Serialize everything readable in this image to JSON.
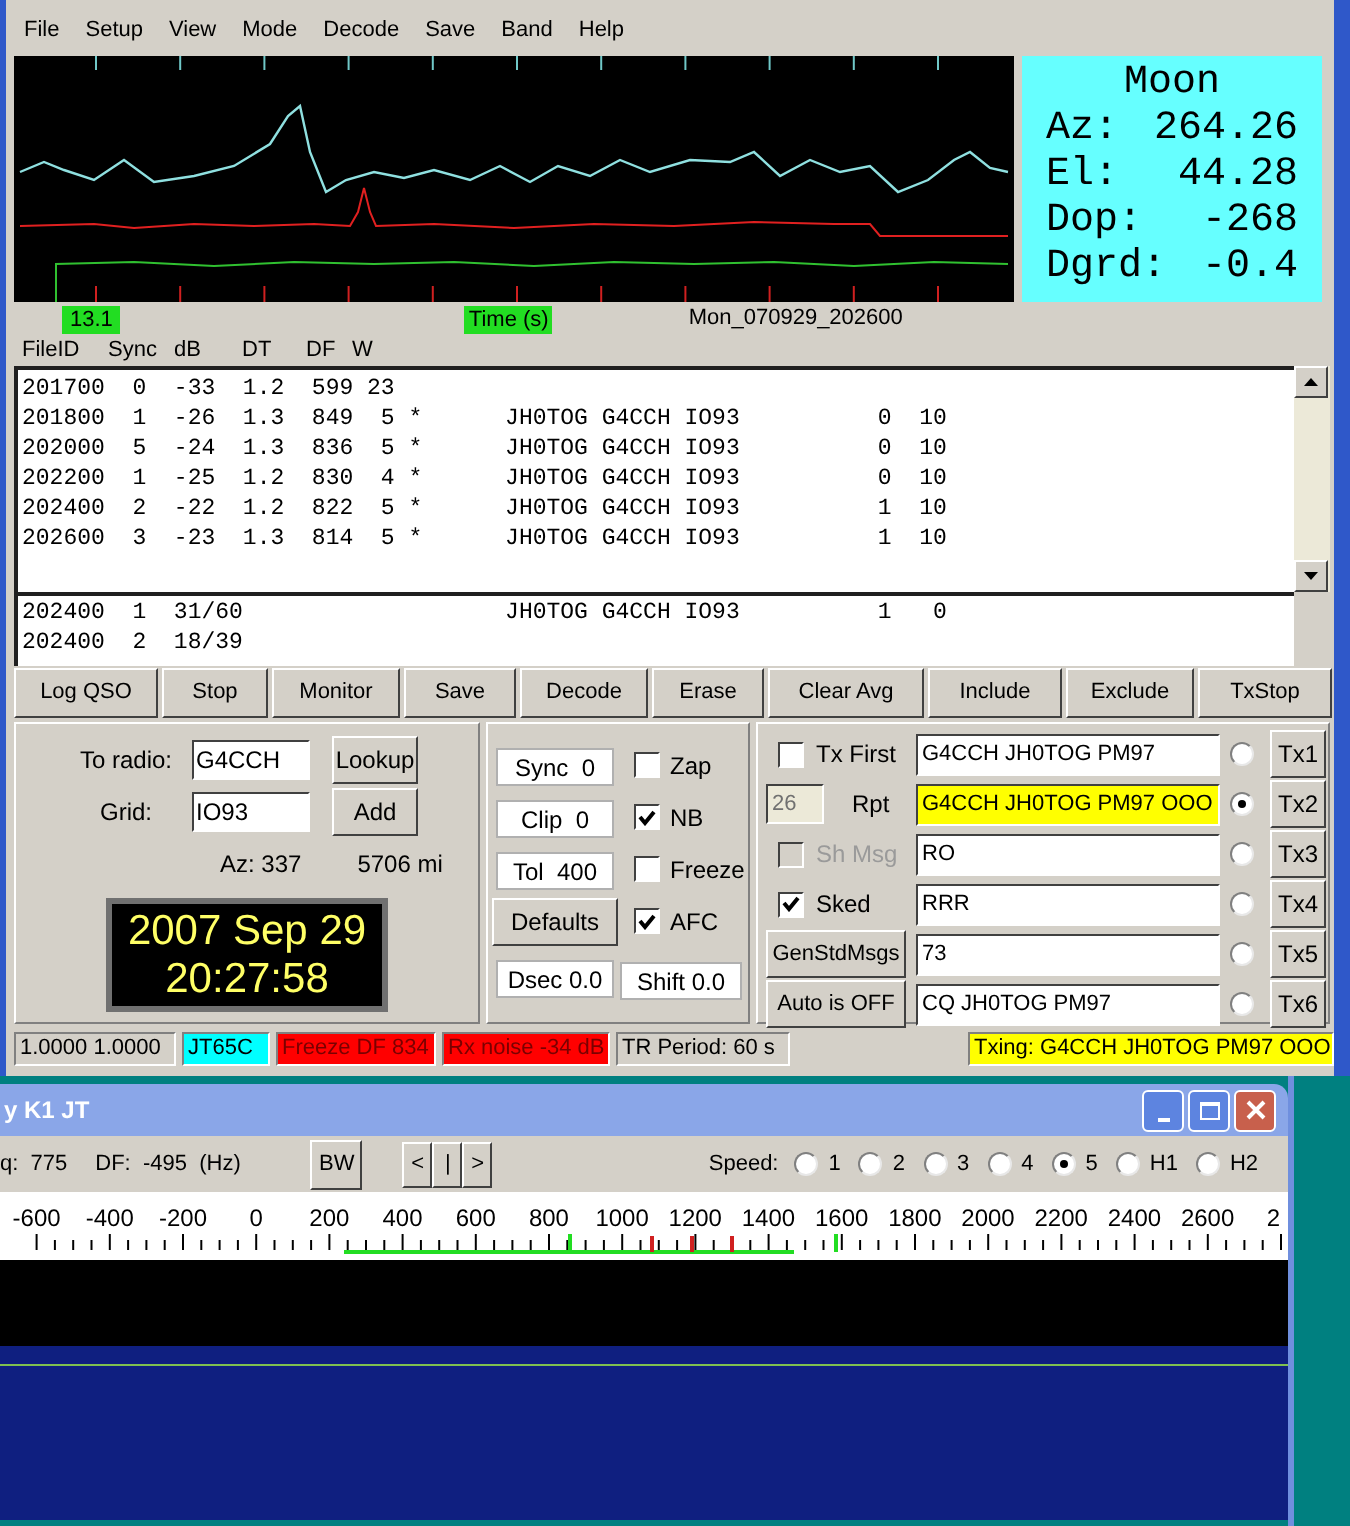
{
  "menu": [
    "File",
    "Setup",
    "View",
    "Mode",
    "Decode",
    "Save",
    "Band",
    "Help"
  ],
  "plot": {
    "readout": "13.1",
    "axis_label": "Time (s)",
    "file_name": "Mon_070929_202600"
  },
  "moon": {
    "title": "Moon",
    "rows": [
      {
        "label": "Az:",
        "value": "264.26"
      },
      {
        "label": "El:",
        "value": "44.28"
      },
      {
        "label": "Dop:",
        "value": "-268"
      },
      {
        "label": "Dgrd:",
        "value": "-0.4"
      }
    ]
  },
  "decoded": {
    "columns": [
      "FileID",
      "Sync",
      "dB",
      "DT",
      "DF",
      "W"
    ],
    "lines": [
      "201700  0  -33  1.2  599 23",
      "201800  1  -26  1.3  849  5 *      JH0TOG G4CCH IO93          0  10",
      "202000  5  -24  1.3  836  5 *      JH0TOG G4CCH IO93          0  10",
      "202200  1  -25  1.2  830  4 *      JH0TOG G4CCH IO93          0  10",
      "202400  2  -22  1.2  822  5 *      JH0TOG G4CCH IO93          1  10",
      "202600  3  -23  1.3  814  5 *      JH0TOG G4CCH IO93          1  10"
    ]
  },
  "average": {
    "lines": [
      "202400  1  31/60                   JH0TOG G4CCH IO93          1   0",
      "202400  2  18/39"
    ]
  },
  "buttons": [
    {
      "label": "Log QSO"
    },
    {
      "label": "Stop"
    },
    {
      "label": "Monitor"
    },
    {
      "label": "Save"
    },
    {
      "label": "Decode"
    },
    {
      "label": "Erase"
    },
    {
      "label": "Clear Avg"
    },
    {
      "label": "Include"
    },
    {
      "label": "Exclude"
    },
    {
      "label": "TxStop"
    }
  ],
  "station": {
    "to_radio_label": "To radio:",
    "to_radio": "G4CCH",
    "grid_label": "Grid:",
    "grid": "IO93",
    "lookup": {
      "label": "Lookup"
    },
    "add": {
      "label": "Add"
    },
    "azimuth": "Az: 337",
    "distance": "5706 mi",
    "date": "2007 Sep 29",
    "time": "20:27:58"
  },
  "settings": {
    "sync": "Sync  0",
    "clip": "Clip  0",
    "tol": "Tol  400",
    "defaults": "Defaults",
    "dsec": "Dsec 0.0",
    "shift": "Shift 0.0",
    "options": [
      {
        "label": "Zap",
        "checked": false
      },
      {
        "label": "NB",
        "checked": true
      },
      {
        "label": "Freeze",
        "checked": false
      },
      {
        "label": "AFC",
        "checked": true
      }
    ]
  },
  "messages": [
    {
      "kind": "checkbox",
      "label": "Tx First",
      "checked": false,
      "disabled": false,
      "text": "G4CCH JH0TOG PM97",
      "highlighted": false,
      "selected": false,
      "tx": {
        "label": "Tx1"
      }
    },
    {
      "kind": "spin",
      "value": "26",
      "label": "Rpt",
      "disabled": true,
      "text": "G4CCH JH0TOG PM97 OOO",
      "highlighted": true,
      "selected": true,
      "tx": {
        "label": "Tx2"
      }
    },
    {
      "kind": "checkbox",
      "label": "Sh Msg",
      "checked": false,
      "disabled": true,
      "text": "RO",
      "highlighted": false,
      "selected": false,
      "tx": {
        "label": "Tx3"
      }
    },
    {
      "kind": "checkbox",
      "label": "Sked",
      "checked": true,
      "disabled": false,
      "text": "RRR",
      "highlighted": false,
      "selected": false,
      "tx": {
        "label": "Tx4"
      }
    },
    {
      "kind": "button",
      "label": "GenStdMsgs",
      "disabled": false,
      "text": "73",
      "highlighted": false,
      "selected": false,
      "tx": {
        "label": "Tx5"
      }
    },
    {
      "kind": "button",
      "label": "Auto is OFF",
      "disabled": false,
      "text": "CQ JH0TOG PM97",
      "highlighted": false,
      "selected": false,
      "tx": {
        "label": "Tx6"
      }
    }
  ],
  "status_bar": [
    {
      "text": "1.0000 1.0000",
      "color": "#d4d0c8"
    },
    {
      "text": "JT65C",
      "color": "#00ffff"
    },
    {
      "text": "Freeze DF  834",
      "color": "#ff0000"
    },
    {
      "text": "Rx noise -34 dB",
      "color": "#ff0000"
    },
    {
      "text": "TR Period: 60 s",
      "color": "#d4d0c8"
    },
    {
      "text": "Txing:  G4CCH JH0TOG PM97 OOO",
      "color": "#ffff00"
    }
  ],
  "spectrum_window": {
    "title": "y K1 JT",
    "freq": "q:  775",
    "df": "DF:  -495  (Hz)",
    "bw": "BW",
    "nav": [
      "<",
      "|",
      ">"
    ],
    "speed_label": "Speed:",
    "speeds": [
      {
        "label": "1",
        "selected": false
      },
      {
        "label": "2",
        "selected": false
      },
      {
        "label": "3",
        "selected": false
      },
      {
        "label": "4",
        "selected": false
      },
      {
        "label": "5",
        "selected": true
      },
      {
        "label": "H1",
        "selected": false
      },
      {
        "label": "H2",
        "selected": false
      }
    ],
    "scale": [
      "-600",
      "-400",
      "-200",
      "0",
      "200",
      "400",
      "600",
      "800",
      "1000",
      "1200",
      "1400",
      "1600",
      "1800",
      "2000",
      "2200",
      "2400",
      "2600",
      "2"
    ]
  }
}
